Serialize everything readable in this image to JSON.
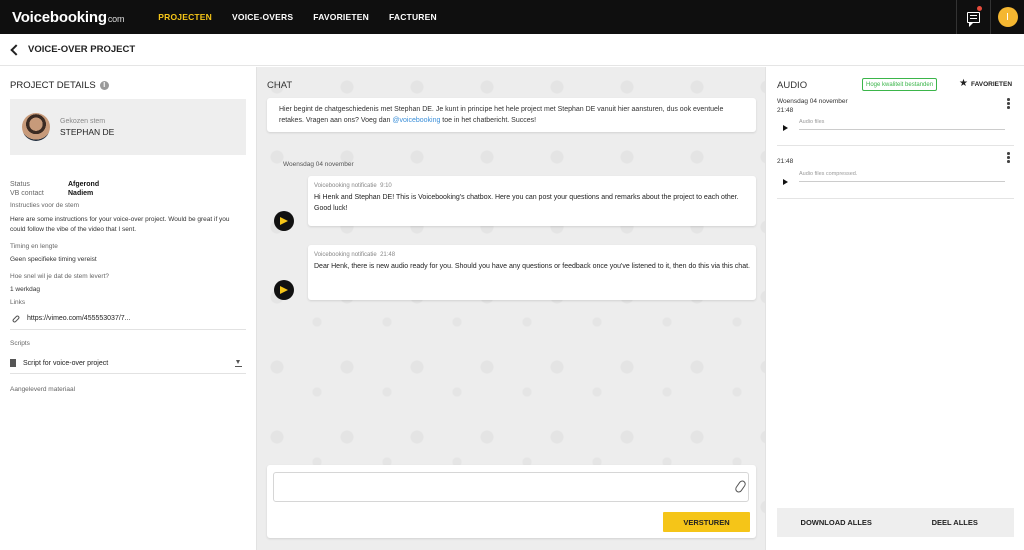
{
  "app": {
    "logo_text": "Voicebooking",
    "logo_suffix": "com"
  },
  "nav": {
    "items": [
      "PROJECTEN",
      "VOICE-OVERS",
      "FAVORIETEN",
      "FACTUREN"
    ],
    "active_index": 0
  },
  "topbar": {
    "avatar_initial": "I",
    "colors": {
      "accent": "#f5c518",
      "notification": "#e74c3c"
    }
  },
  "header": {
    "title": "VOICE-OVER PROJECT"
  },
  "details": {
    "title": "PROJECT DETAILS",
    "voice_label": "Gekozen stem",
    "voice_name": "STEPHAN DE",
    "status_label": "Status",
    "status_value": "Afgerond",
    "contact_label": "VB contact",
    "contact_value": "Nadiem",
    "instructions_label": "Instructies voor de stem",
    "instructions_text": "Here are some instructions for your voice-over project. Would be great if you could follow the vibe of the video that I sent.",
    "timing_label": "Timing en lengte",
    "timing_value": "Geen specifieke timing vereist",
    "delivery_label": "Hoe snel wil je dat de stem levert?",
    "delivery_value": "1 werkdag",
    "links_label": "Links",
    "link_value": "https://vimeo.com/455553037/7...",
    "scripts_label": "Scripts",
    "script_name": "Script for voice-over project",
    "materials_label": "Aangeleverd materiaal"
  },
  "chat": {
    "title": "CHAT",
    "intro_before": "Hier begint de chatgeschiedenis met Stephan DE. Je kunt in principe het hele project met Stephan DE vanuit hier aansturen, dus ook eventuele retakes. Vragen aan ons? Voeg dan ",
    "intro_mention": "@voicebooking",
    "intro_after": " toe in het chatbericht. Succes!",
    "date_label": "Woensdag 04 november",
    "messages": [
      {
        "sender": "Voicebooking notificatie",
        "time": "9:10",
        "text": "Hi Henk and Stephan DE! This is Voicebooking's chatbox. Here you can post your questions and remarks about the project to each other. Good luck!"
      },
      {
        "sender": "Voicebooking notificatie",
        "time": "21:48",
        "text": "Dear Henk, there is new audio ready for you. Should you have any questions or feedback once you've listened to it, then do this via this chat."
      }
    ],
    "input_value": "",
    "send_label": "VERSTUREN"
  },
  "audio": {
    "title": "AUDIO",
    "hq_badge": "Hoge kwaliteit bestanden",
    "favorites_label": "FAVORIETEN",
    "items": [
      {
        "date": "Woensdag 04 november",
        "time": "21:48",
        "file_label": "Audio files"
      },
      {
        "time": "21:48",
        "file_label": "Audio files compressed."
      }
    ],
    "download_all": "DOWNLOAD ALLES",
    "share_all": "DEEL ALLES"
  }
}
